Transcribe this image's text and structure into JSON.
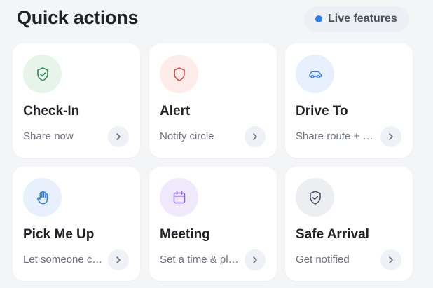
{
  "header": {
    "title": "Quick actions",
    "live_label": "Live features",
    "live_dot_color": "#2f80ed"
  },
  "cards": [
    {
      "title": "Check-In",
      "subtitle": "Share now",
      "icon": "shield-check-icon",
      "icon_color": "#2e8b57",
      "icon_bg": "#e6f4ea"
    },
    {
      "title": "Alert",
      "subtitle": "Notify circle",
      "icon": "shield-icon",
      "icon_color": "#d84c3f",
      "icon_bg": "#fdecea"
    },
    {
      "title": "Drive To",
      "subtitle": "Share route + ETA",
      "icon": "car-icon",
      "icon_color": "#2f80ed",
      "icon_bg": "#e8f0fd"
    },
    {
      "title": "Pick Me Up",
      "subtitle": "Let someone come to you",
      "icon": "hand-icon",
      "icon_color": "#2f80ed",
      "icon_bg": "#e8f0fd"
    },
    {
      "title": "Meeting",
      "subtitle": "Set a time & place",
      "icon": "calendar-icon",
      "icon_color": "#8b5cf6",
      "icon_bg": "#efe9fb"
    },
    {
      "title": "Safe Arrival",
      "subtitle": "Get notified",
      "icon": "shield-check-icon",
      "icon_color": "#4b5563",
      "icon_bg": "#eceef2"
    }
  ]
}
